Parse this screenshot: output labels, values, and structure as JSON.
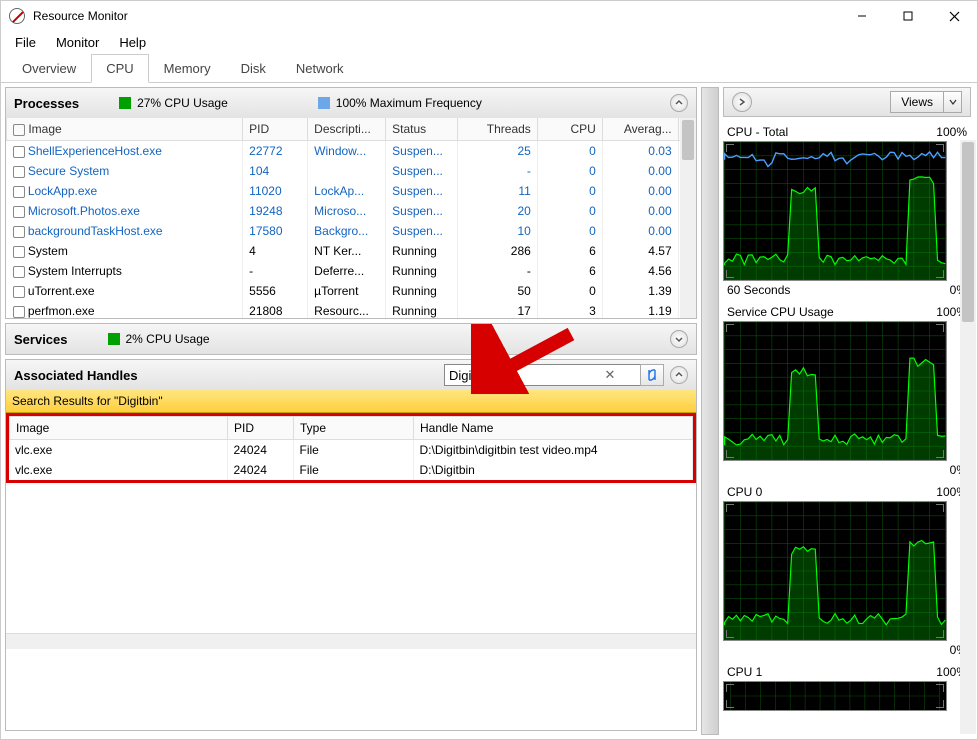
{
  "window": {
    "title": "Resource Monitor"
  },
  "menu": {
    "file": "File",
    "monitor": "Monitor",
    "help": "Help"
  },
  "tabs": {
    "overview": "Overview",
    "cpu": "CPU",
    "memory": "Memory",
    "disk": "Disk",
    "network": "Network"
  },
  "processes": {
    "title": "Processes",
    "stat1_color": "#00a000",
    "stat1_text": "27% CPU Usage",
    "stat2_color": "#6ca8e8",
    "stat2_text": "100% Maximum Frequency",
    "cols": {
      "image": "Image",
      "pid": "PID",
      "desc": "Descripti...",
      "status": "Status",
      "threads": "Threads",
      "cpu": "CPU",
      "avg": "Averag..."
    },
    "rows": [
      {
        "link": true,
        "image": "ShellExperienceHost.exe",
        "pid": "22772",
        "desc": "Window...",
        "status": "Suspen...",
        "threads": "25",
        "cpu": "0",
        "avg": "0.03"
      },
      {
        "link": true,
        "image": "Secure System",
        "pid": "104",
        "desc": "",
        "status": "Suspen...",
        "threads": "-",
        "cpu": "0",
        "avg": "0.00"
      },
      {
        "link": true,
        "image": "LockApp.exe",
        "pid": "11020",
        "desc": "LockAp...",
        "status": "Suspen...",
        "threads": "11",
        "cpu": "0",
        "avg": "0.00"
      },
      {
        "link": true,
        "image": "Microsoft.Photos.exe",
        "pid": "19248",
        "desc": "Microso...",
        "status": "Suspen...",
        "threads": "20",
        "cpu": "0",
        "avg": "0.00"
      },
      {
        "link": true,
        "image": "backgroundTaskHost.exe",
        "pid": "17580",
        "desc": "Backgro...",
        "status": "Suspen...",
        "threads": "10",
        "cpu": "0",
        "avg": "0.00"
      },
      {
        "link": false,
        "image": "System",
        "pid": "4",
        "desc": "NT Ker...",
        "status": "Running",
        "threads": "286",
        "cpu": "6",
        "avg": "4.57"
      },
      {
        "link": false,
        "image": "System Interrupts",
        "pid": "-",
        "desc": "Deferre...",
        "status": "Running",
        "threads": "-",
        "cpu": "6",
        "avg": "4.56"
      },
      {
        "link": false,
        "image": "uTorrent.exe",
        "pid": "5556",
        "desc": "µTorrent",
        "status": "Running",
        "threads": "50",
        "cpu": "0",
        "avg": "1.39"
      },
      {
        "link": false,
        "image": "perfmon.exe",
        "pid": "21808",
        "desc": "Resourc...",
        "status": "Running",
        "threads": "17",
        "cpu": "3",
        "avg": "1.19"
      }
    ]
  },
  "services": {
    "title": "Services",
    "stat1_color": "#00a000",
    "stat1_text": "2% CPU Usage"
  },
  "handles": {
    "title": "Associated Handles",
    "search_value": "Digitbin",
    "results_banner": "Search Results for \"Digitbin\"",
    "cols": {
      "image": "Image",
      "pid": "PID",
      "type": "Type",
      "handle": "Handle Name"
    },
    "rows": [
      {
        "image": "vlc.exe",
        "pid": "24024",
        "type": "File",
        "handle": "D:\\Digitbin\\digitbin test video.mp4"
      },
      {
        "image": "vlc.exe",
        "pid": "24024",
        "type": "File",
        "handle": "D:\\Digitbin"
      }
    ]
  },
  "right": {
    "views_label": "Views",
    "graphs": [
      {
        "title": "CPU - Total",
        "right": "100%",
        "footer_left": "60 Seconds",
        "footer_right": "0%",
        "blue": true
      },
      {
        "title": "Service CPU Usage",
        "right": "100%",
        "footer_left": "",
        "footer_right": "0%",
        "blue": false
      },
      {
        "title": "CPU 0",
        "right": "100%",
        "footer_left": "",
        "footer_right": "0%",
        "blue": false
      },
      {
        "title": "CPU 1",
        "right": "100%",
        "footer_left": "",
        "footer_right": "",
        "blue": false,
        "short": true
      }
    ]
  }
}
